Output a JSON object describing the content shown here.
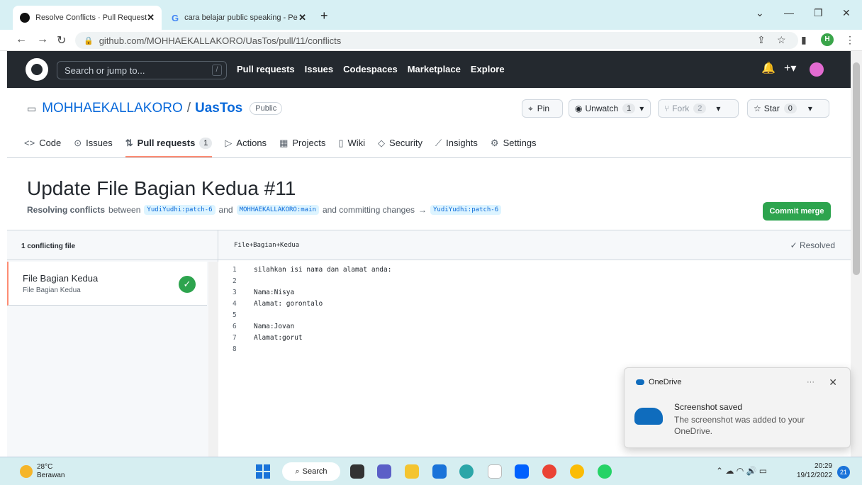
{
  "browser": {
    "tabs": [
      {
        "title": "Resolve Conflicts · Pull Request #",
        "close": "✕"
      },
      {
        "title": "cara belajar public speaking - Pe",
        "close": "✕"
      }
    ],
    "new_tab": "+",
    "url": "github.com/MOHHAEKALLAKORO/UasTos/pull/11/conflicts",
    "profile_initial": "H"
  },
  "github": {
    "search_placeholder": "Search or jump to...",
    "search_shortcut": "/",
    "nav": [
      "Pull requests",
      "Issues",
      "Codespaces",
      "Marketplace",
      "Explore"
    ]
  },
  "repo": {
    "owner": "MOHHAEKALLAKORO",
    "separator": "/",
    "name": "UasTos",
    "visibility": "Public",
    "pin_label": "Pin",
    "unwatch_label": "Unwatch",
    "unwatch_count": "1",
    "fork_label": "Fork",
    "fork_count": "2",
    "star_label": "Star",
    "star_count": "0",
    "tabs": [
      {
        "label": "Code",
        "icon": "<>"
      },
      {
        "label": "Issues",
        "icon": "⊙"
      },
      {
        "label": "Pull requests",
        "icon": "⇅",
        "count": "1"
      },
      {
        "label": "Actions",
        "icon": "▷"
      },
      {
        "label": "Projects",
        "icon": "▦"
      },
      {
        "label": "Wiki",
        "icon": "▯"
      },
      {
        "label": "Security",
        "icon": "◇"
      },
      {
        "label": "Insights",
        "icon": "⟋"
      },
      {
        "label": "Settings",
        "icon": "⚙"
      }
    ]
  },
  "pr": {
    "title": "Update File Bagian Kedua #11",
    "resolving": "Resolving conflicts",
    "between": "between",
    "head_branch": "YudiYudhi:patch-6",
    "and": "and",
    "base_branch": "MOHHAEKALLAKORO:main",
    "committing": "and committing changes",
    "arrow": "→",
    "target_branch": "YudiYudhi:patch-6",
    "commit_button": "Commit merge"
  },
  "conflicts": {
    "count_label": "1 conflicting file",
    "file_name": "File Bagian Kedua",
    "file_path": "File Bagian Kedua",
    "editor_filename": "File+Bagian+Kedua",
    "resolved_label": "✓ Resolved",
    "lines": [
      {
        "n": "1",
        "text": "silahkan isi nama dan alamat anda:"
      },
      {
        "n": "2",
        "text": ""
      },
      {
        "n": "3",
        "text": "Nama:Nisya"
      },
      {
        "n": "4",
        "text": "Alamat: gorontalo"
      },
      {
        "n": "5",
        "text": ""
      },
      {
        "n": "6",
        "text": "Nama:Jovan"
      },
      {
        "n": "7",
        "text": "Alamat:gorut"
      },
      {
        "n": "8",
        "text": ""
      }
    ]
  },
  "toast": {
    "app": "OneDrive",
    "more": "···",
    "close": "✕",
    "title": "Screenshot saved",
    "body": "The screenshot was added to your OneDrive."
  },
  "taskbar": {
    "temp": "28°C",
    "weather": "Berawan",
    "search": "Search",
    "time": "20:29",
    "date": "19/12/2022",
    "notifications": "21"
  },
  "colors": {
    "gh_header": "#24292f",
    "commit_green": "#2da44e",
    "link_blue": "#0969da",
    "active_tab_accent": "#fd8c73"
  }
}
